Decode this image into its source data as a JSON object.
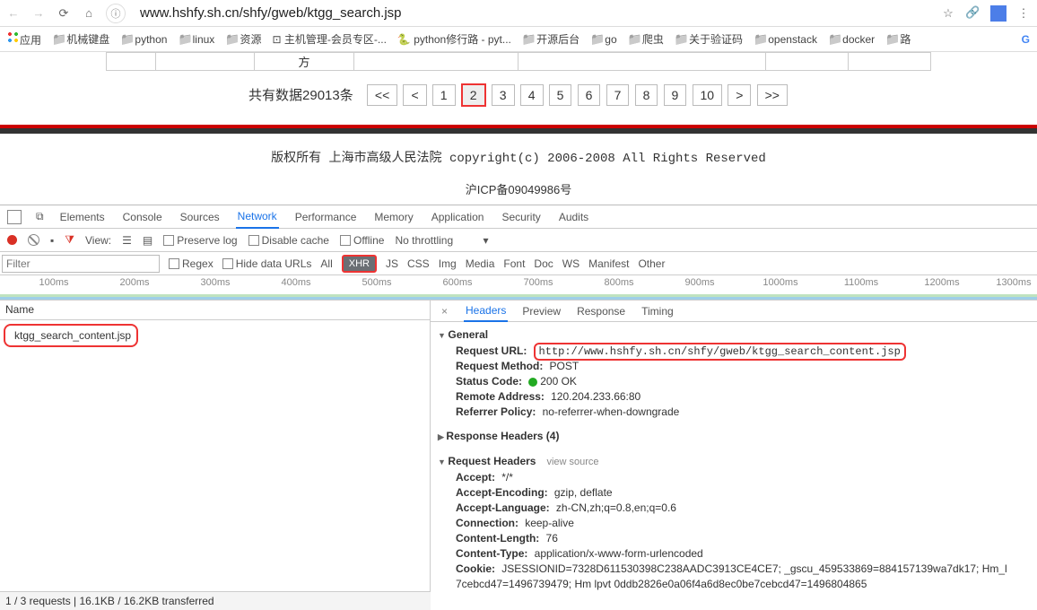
{
  "nav": {
    "url": "www.hshfy.sh.cn/shfy/gweb/ktgg_search.jsp"
  },
  "bookmarks": {
    "apps": "应用",
    "items": [
      "机械键盘",
      "python",
      "linux",
      "资源",
      "主机管理-会员专区-...",
      "python修行路 - pyt...",
      "开源后台",
      "go",
      "爬虫",
      "关于验证码",
      "openstack",
      "docker",
      "路"
    ]
  },
  "page": {
    "cell": "方",
    "pager_text": "共有数据29013条",
    "btns": [
      "<<",
      "<",
      "1",
      "2",
      "3",
      "4",
      "5",
      "6",
      "7",
      "8",
      "9",
      "10",
      ">",
      ">>"
    ],
    "footer": "版权所有 上海市高级人民法院 copyright(c) 2006-2008 All Rights Reserved",
    "icp": "沪ICP备09049986号"
  },
  "devtools": {
    "tabs": [
      "Elements",
      "Console",
      "Sources",
      "Network",
      "Performance",
      "Memory",
      "Application",
      "Security",
      "Audits"
    ],
    "view": "View:",
    "preserve": "Preserve log",
    "disable": "Disable cache",
    "offline": "Offline",
    "throttle": "No throttling",
    "filter_ph": "Filter",
    "regex": "Regex",
    "hide": "Hide data URLs",
    "cats": [
      "All",
      "XHR",
      "JS",
      "CSS",
      "Img",
      "Media",
      "Font",
      "Doc",
      "WS",
      "Manifest",
      "Other"
    ],
    "ticks": [
      "100ms",
      "200ms",
      "300ms",
      "400ms",
      "500ms",
      "600ms",
      "700ms",
      "800ms",
      "900ms",
      "1000ms",
      "1100ms",
      "1200ms",
      "1300ms"
    ],
    "name_hdr": "Name",
    "req_name": "ktgg_search_content.jsp",
    "status": "1 / 3 requests | 16.1KB / 16.2KB transferred",
    "rtabs": [
      "Headers",
      "Preview",
      "Response",
      "Timing"
    ],
    "general": "General",
    "url_l": "Request URL:",
    "url_v": "http://www.hshfy.sh.cn/shfy/gweb/ktgg_search_content.jsp",
    "method_l": "Request Method:",
    "method_v": "POST",
    "code_l": "Status Code:",
    "code_v": "200 OK",
    "remote_l": "Remote Address:",
    "remote_v": "120.204.233.66:80",
    "ref_l": "Referrer Policy:",
    "ref_v": "no-referrer-when-downgrade",
    "rh": "Response Headers (4)",
    "rqh": "Request Headers",
    "vs": "view source",
    "h": {
      "accept_l": "Accept:",
      "accept_v": "*/*",
      "ae_l": "Accept-Encoding:",
      "ae_v": "gzip, deflate",
      "al_l": "Accept-Language:",
      "al_v": "zh-CN,zh;q=0.8,en;q=0.6",
      "conn_l": "Connection:",
      "conn_v": "keep-alive",
      "cl_l": "Content-Length:",
      "cl_v": "76",
      "ct_l": "Content-Type:",
      "ct_v": "application/x-www-form-urlencoded",
      "ck_l": "Cookie:",
      "ck_v": "JSESSIONID=7328D611530398C238AADC3913CE4CE7; _gscu_459533869=884157139wa7dk17; Hm_l",
      "ck_v2": "7cebcd47=1496739479; Hm lpvt 0ddb2826e0a06f4a6d8ec0be7cebcd47=1496804865"
    }
  }
}
